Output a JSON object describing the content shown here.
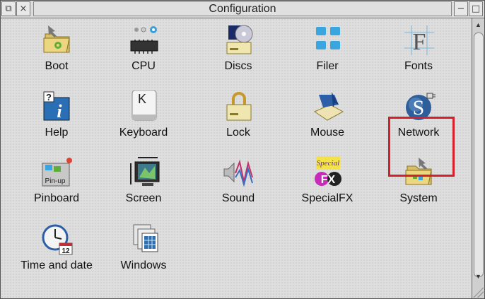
{
  "window": {
    "title": "Configuration"
  },
  "titlebar": {
    "back_glyph": "⧉",
    "close_glyph": "×",
    "iconise_glyph": "−",
    "toggle_glyph": "□"
  },
  "items": [
    {
      "label": "Boot",
      "icon": "boot-folder-icon"
    },
    {
      "label": "CPU",
      "icon": "cpu-chip-icon"
    },
    {
      "label": "Discs",
      "icon": "discs-icon"
    },
    {
      "label": "Filer",
      "icon": "filer-icon"
    },
    {
      "label": "Fonts",
      "icon": "fonts-icon"
    },
    {
      "label": "Help",
      "icon": "help-icon"
    },
    {
      "label": "Keyboard",
      "icon": "keyboard-key-icon"
    },
    {
      "label": "Lock",
      "icon": "lock-icon"
    },
    {
      "label": "Mouse",
      "icon": "mouse-icon"
    },
    {
      "label": "Network",
      "icon": "network-plug-icon",
      "highlighted": true
    },
    {
      "label": "Pinboard",
      "icon": "pinboard-icon"
    },
    {
      "label": "Screen",
      "icon": "screen-monitor-icon"
    },
    {
      "label": "Sound",
      "icon": "sound-waveform-icon"
    },
    {
      "label": "SpecialFX",
      "icon": "specialfx-icon"
    },
    {
      "label": "System",
      "icon": "system-folder-icon"
    },
    {
      "label": "Time and date",
      "icon": "clock-calendar-icon"
    },
    {
      "label": "Windows",
      "icon": "windows-stack-icon"
    }
  ],
  "help_icon": {
    "mark": "?",
    "letter": "i"
  },
  "keyboard_icon": {
    "key": "K"
  },
  "fonts_icon": {
    "letter": "F"
  },
  "network_icon": {
    "letter": "S"
  },
  "pinboard_icon": {
    "text": "Pin-up"
  },
  "specialfx_icon": {
    "word": "Special",
    "letters": "FX"
  },
  "clock_icon": {
    "day": "12"
  },
  "colors": {
    "highlight": "#d4202a",
    "background": "#dcdcdc"
  }
}
